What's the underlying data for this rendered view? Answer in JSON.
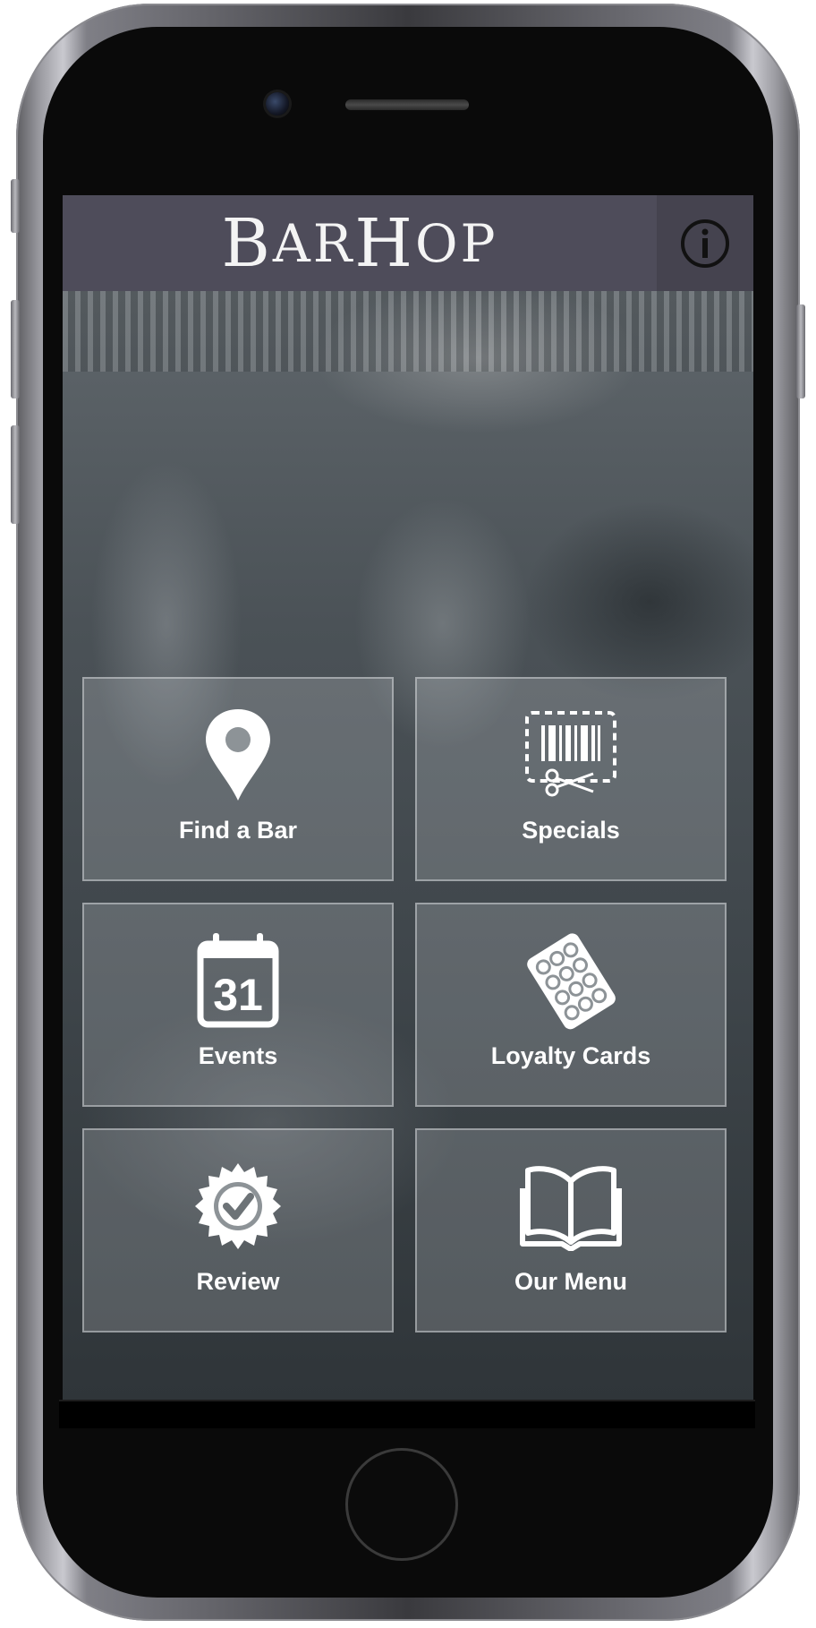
{
  "app": {
    "title_first_cap": "B",
    "title_first_rest": "AR",
    "title_second_cap": "H",
    "title_second_rest": "OP",
    "info_icon": "info-icon"
  },
  "menu": {
    "tiles": [
      {
        "label": "Find a Bar",
        "icon": "map-pin-icon"
      },
      {
        "label": "Specials",
        "icon": "coupon-icon"
      },
      {
        "label": "Events",
        "icon": "calendar-icon",
        "calendar_day": "31"
      },
      {
        "label": "Loyalty Cards",
        "icon": "punch-card-icon"
      },
      {
        "label": "Review",
        "icon": "check-badge-icon"
      },
      {
        "label": "Our Menu",
        "icon": "open-book-icon"
      }
    ]
  },
  "colors": {
    "header": "#4e4c5a",
    "info_button": "#45434f",
    "tile_text": "#ffffff"
  }
}
